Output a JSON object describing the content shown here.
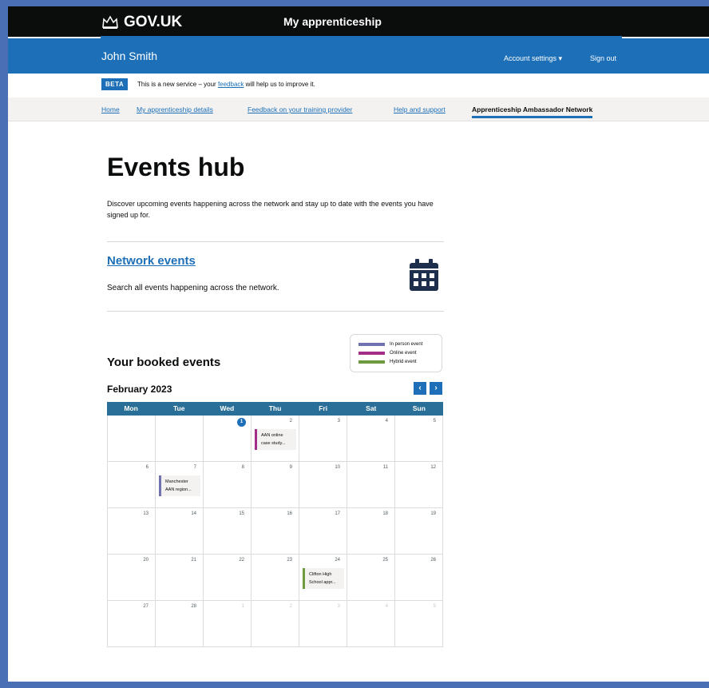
{
  "header": {
    "logo_text": "GOV.UK",
    "service_name": "My apprenticeship",
    "user_name": "John Smith",
    "account_settings": "Account settings ▾",
    "sign_out": "Sign out"
  },
  "beta": {
    "tag": "BETA",
    "text_before": "This is a new service – your",
    "link": "feedback",
    "text_after": "will help us to improve it."
  },
  "nav": {
    "items": [
      "Home",
      "My apprenticeship details",
      "Feedback on your training provider",
      "Help and support",
      "Apprenticeship Ambassador Network"
    ]
  },
  "main": {
    "title": "Events hub",
    "intro": "Discover upcoming events happening across the network and stay up to date with the events you have signed up for.",
    "network_link": "Network events",
    "network_desc": "Search all events happening across the network.",
    "icon": "calendar-icon"
  },
  "legend": {
    "items": [
      {
        "label": "In person event",
        "color": "#6f72af"
      },
      {
        "label": "Online event",
        "color": "#a22e8a"
      },
      {
        "label": "Hybrid event",
        "color": "#6e9a3f"
      }
    ]
  },
  "calendar": {
    "section_title": "Your booked events",
    "month": "February 2023",
    "prev": "‹",
    "next": "›",
    "days": [
      "Mon",
      "Tue",
      "Wed",
      "Thu",
      "Fri",
      "Sat",
      "Sun"
    ],
    "weeks": [
      [
        {
          "num": "",
          "other": true
        },
        {
          "num": "",
          "other": true
        },
        {
          "num": "1",
          "today": true
        },
        {
          "num": "2",
          "event": {
            "line1": "AAN online",
            "line2": "case study...",
            "color": "#a22e8a"
          }
        },
        {
          "num": "3"
        },
        {
          "num": "4"
        },
        {
          "num": "5"
        }
      ],
      [
        {
          "num": "6"
        },
        {
          "num": "7",
          "event": {
            "line1": "Manchester",
            "line2": "AAN region...",
            "color": "#6f72af"
          }
        },
        {
          "num": "8"
        },
        {
          "num": "9"
        },
        {
          "num": "10"
        },
        {
          "num": "11"
        },
        {
          "num": "12"
        }
      ],
      [
        {
          "num": "13"
        },
        {
          "num": "14"
        },
        {
          "num": "15"
        },
        {
          "num": "16"
        },
        {
          "num": "17"
        },
        {
          "num": "18"
        },
        {
          "num": "19"
        }
      ],
      [
        {
          "num": "20"
        },
        {
          "num": "21"
        },
        {
          "num": "22"
        },
        {
          "num": "23"
        },
        {
          "num": "24",
          "event": {
            "line1": "Clifton High",
            "line2": "School appr...",
            "color": "#6e9a3f"
          }
        },
        {
          "num": "25"
        },
        {
          "num": "26"
        }
      ],
      [
        {
          "num": "27"
        },
        {
          "num": "28"
        },
        {
          "num": "1",
          "other": true
        },
        {
          "num": "2",
          "other": true
        },
        {
          "num": "3",
          "other": true
        },
        {
          "num": "4",
          "other": true
        },
        {
          "num": "5",
          "other": true
        }
      ]
    ]
  }
}
